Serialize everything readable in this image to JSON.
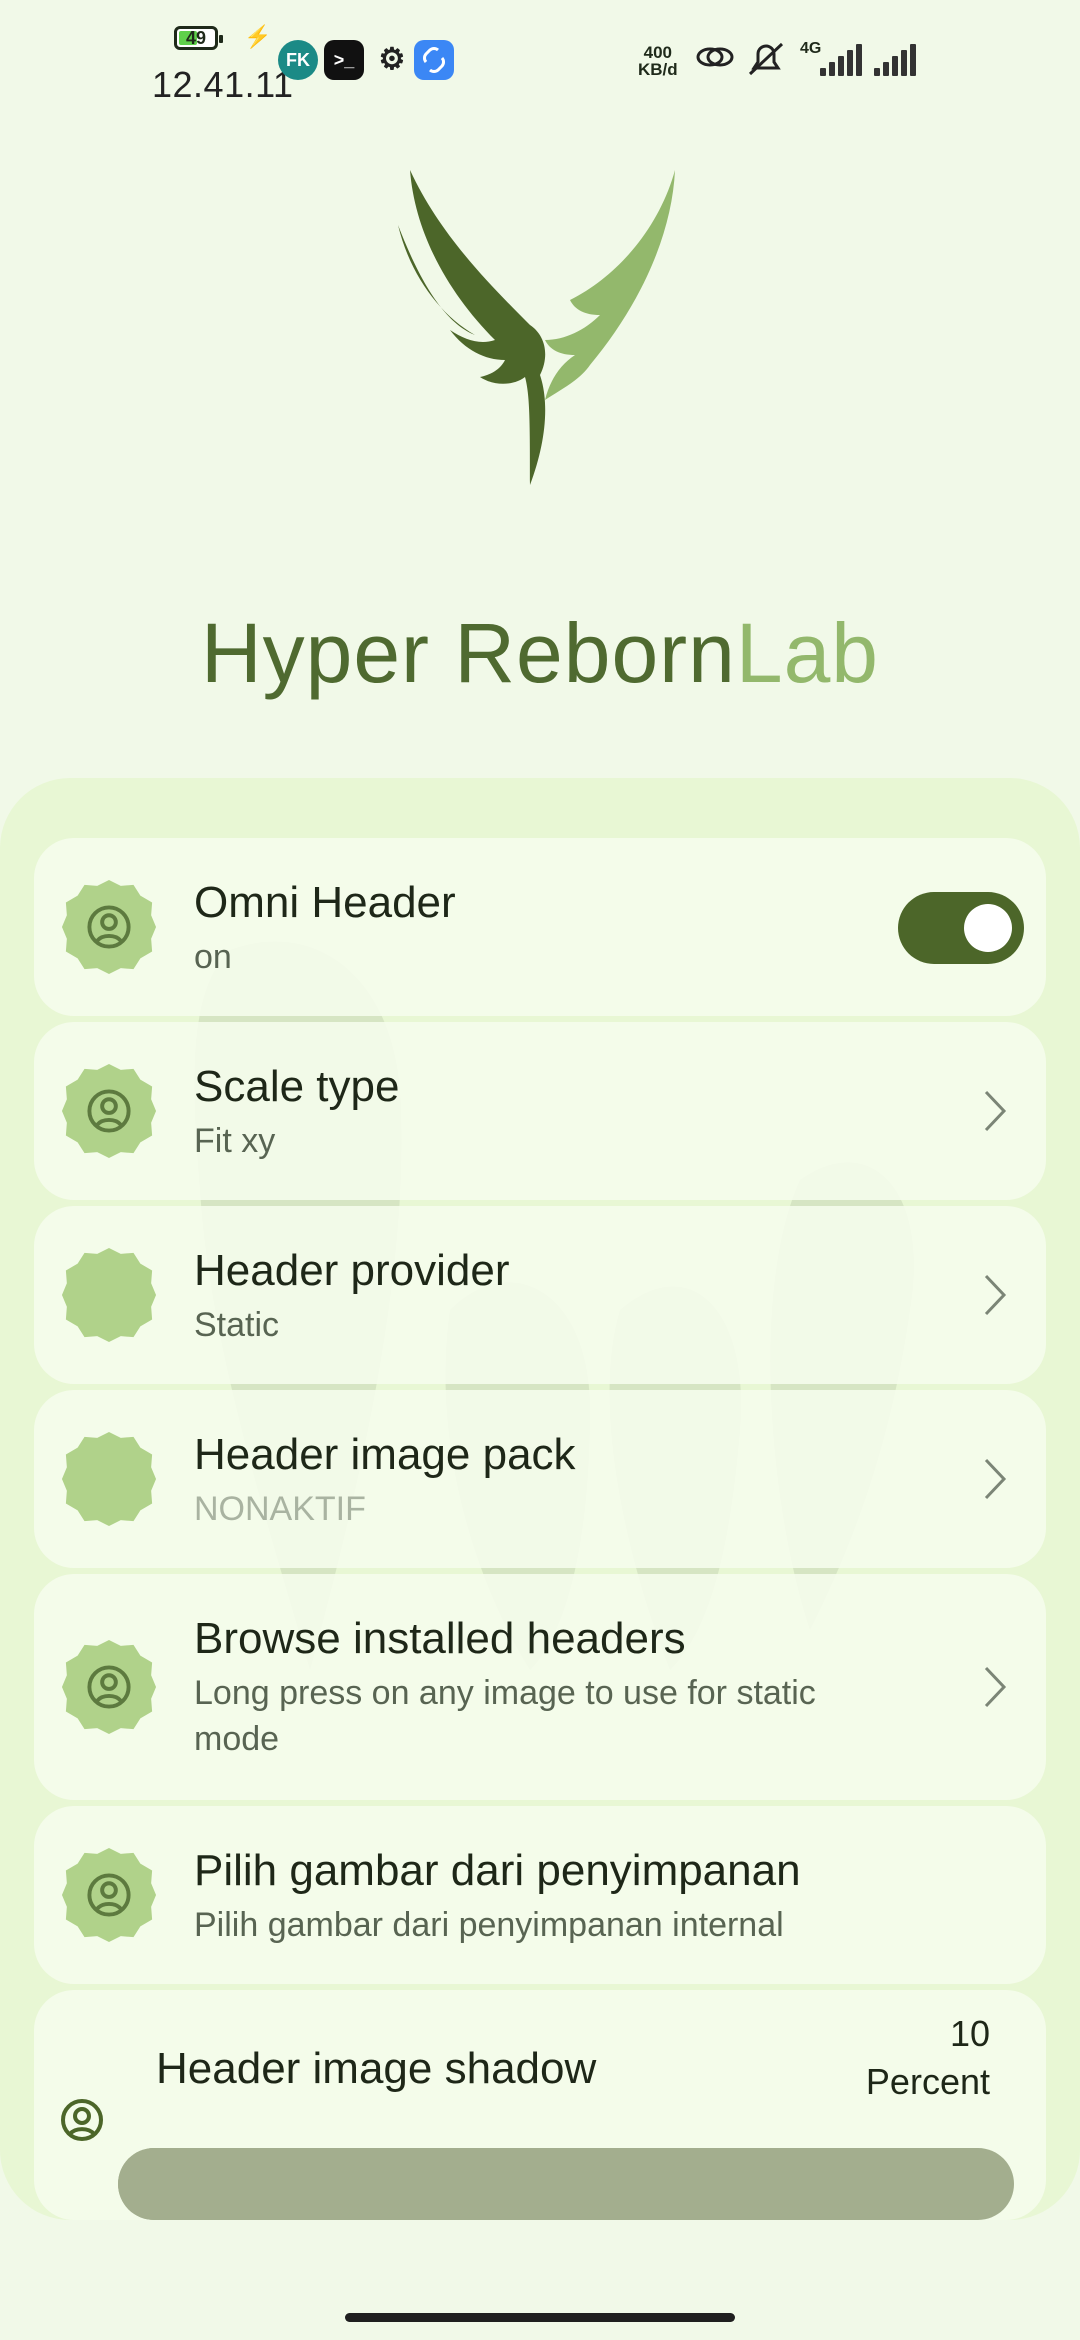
{
  "status_bar": {
    "battery_level": "49",
    "time": "12.41.11",
    "app_fk_label": "FK",
    "app_terminal_label": ">_",
    "net_speed_value": "400",
    "net_speed_unit": "KB/d",
    "network_type": "4G",
    "icons": [
      "battery-icon",
      "charging-icon",
      "fk-app-icon",
      "terminal-icon",
      "settings-gear-icon",
      "link-app-icon",
      "hotspot-icon",
      "mute-icon",
      "signal-icon",
      "signal-2-icon"
    ]
  },
  "header": {
    "title_main": "Hyper Reborn",
    "title_accent": "Lab",
    "logo_icon": "wings-logo-icon",
    "colors": {
      "primary": "#4c6629",
      "accent": "#93b86c",
      "background": "#f1f9e8"
    }
  },
  "settings": [
    {
      "title": "Omni Header",
      "subtitle": "on",
      "icon": "user-circle-icon",
      "control": "toggle",
      "toggle_on": true
    },
    {
      "title": "Scale type",
      "subtitle": "Fit xy",
      "icon": "user-circle-icon",
      "control": "chevron"
    },
    {
      "title": "Header provider",
      "subtitle": "Static",
      "icon": "blank-badge-icon",
      "control": "chevron"
    },
    {
      "title": "Header image pack",
      "subtitle": "NONAKTIF",
      "icon": "blank-badge-icon",
      "control": "chevron"
    },
    {
      "title": "Browse installed headers",
      "subtitle_line1": "Long press on any image to use for static",
      "subtitle_line2": "mode",
      "icon": "user-circle-icon",
      "control": "chevron"
    },
    {
      "title": "Pilih gambar dari penyimpanan",
      "subtitle": "Pilih gambar dari penyimpanan internal",
      "icon": "user-circle-icon",
      "control": "none"
    }
  ],
  "shadow": {
    "title": "Header image shadow",
    "value": "10",
    "unit": "Percent",
    "slider_value_percent": 10
  }
}
